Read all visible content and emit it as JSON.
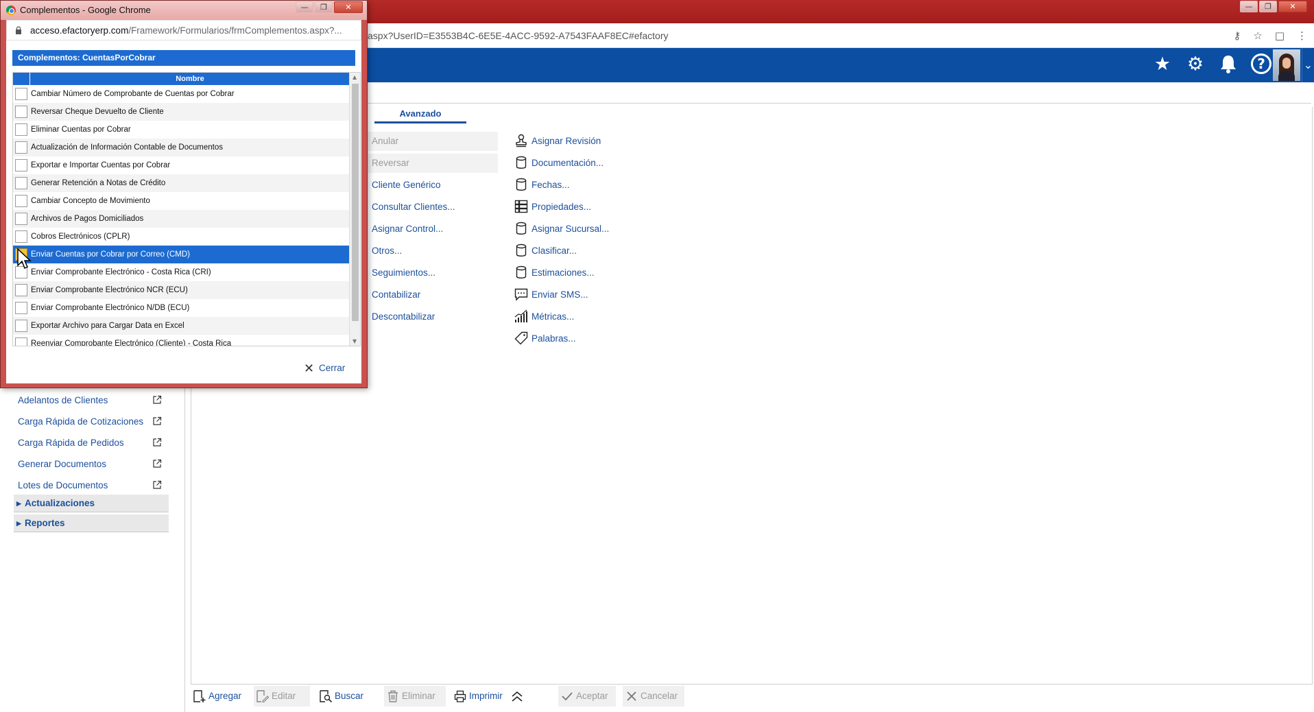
{
  "main_window": {
    "url": "aspx?UserID=E3553B4C-6E5E-4ACC-9592-A7543FAAF8EC#efactory"
  },
  "header": {
    "icons": [
      "star-icon",
      "gear-icon",
      "bell-icon",
      "help-icon"
    ],
    "brand_color": "#0b4ea2"
  },
  "tabs": {
    "active": "Avanzado"
  },
  "actions_left": [
    {
      "label": "Anular",
      "disabled": true
    },
    {
      "label": "Reversar",
      "disabled": true
    },
    {
      "label": "Cliente Genérico",
      "disabled": false
    },
    {
      "label": "Consultar Clientes...",
      "disabled": false
    },
    {
      "label": "Asignar Control...",
      "disabled": false
    },
    {
      "label": "Otros...",
      "disabled": false
    },
    {
      "label": "Seguimientos...",
      "disabled": false
    },
    {
      "label": "Contabilizar",
      "disabled": false
    },
    {
      "label": "Descontabilizar",
      "disabled": false
    }
  ],
  "actions_right": [
    {
      "label": "Asignar Revisión",
      "icon": "stamp-icon"
    },
    {
      "label": "Documentación...",
      "icon": "database-icon"
    },
    {
      "label": "Fechas...",
      "icon": "database-icon"
    },
    {
      "label": "Propiedades...",
      "icon": "grid-icon"
    },
    {
      "label": "Asignar Sucursal...",
      "icon": "database-icon"
    },
    {
      "label": "Clasificar...",
      "icon": "database-icon"
    },
    {
      "label": "Estimaciones...",
      "icon": "database-icon"
    },
    {
      "label": "Enviar SMS...",
      "icon": "chat-icon"
    },
    {
      "label": "Métricas...",
      "icon": "metrics-icon"
    },
    {
      "label": "Palabras...",
      "icon": "tag-icon"
    }
  ],
  "sidebar": {
    "links": [
      "Adelantos de Clientes",
      "Carga Rápida de Cotizaciones",
      "Carga Rápida de Pedidos",
      "Generar Documentos",
      "Lotes de Documentos"
    ],
    "sections": [
      "Actualizaciones",
      "Reportes"
    ]
  },
  "bottom_toolbar": [
    {
      "label": "Agregar",
      "disabled": false
    },
    {
      "label": "Editar",
      "disabled": true
    },
    {
      "label": "Buscar",
      "disabled": false
    },
    {
      "label": "Eliminar",
      "disabled": true
    },
    {
      "label": "Imprimir",
      "disabled": false
    },
    {
      "label": "Aceptar",
      "disabled": true
    },
    {
      "label": "Cancelar",
      "disabled": true
    }
  ],
  "popup": {
    "window_title": "Complementos - Google Chrome",
    "url_host": "acceso.efactoryerp.com",
    "url_path": "/Framework/Formularios/frmComplementos.aspx?...",
    "dialog_title": "Complementos: CuentasPorCobrar",
    "grid_header": "Nombre",
    "rows": [
      "Cambiar Número de Comprobante de Cuentas por Cobrar",
      "Reversar Cheque Devuelto de Cliente",
      "Eliminar Cuentas por Cobrar",
      "Actualización de Información Contable de Documentos",
      "Exportar e Importar Cuentas por Cobrar",
      "Generar Retención a Notas de Crédito",
      "Cambiar Concepto de Movimiento",
      "Archivos de Pagos Domiciliados",
      "Cobros Electrónicos (CPLR)",
      "Enviar Cuentas por Cobrar por Correo (CMD)",
      "Enviar Comprobante Electrónico - Costa Rica (CRI)",
      "Enviar Comprobante Electrónico NCR (ECU)",
      "Enviar Comprobante Electrónico N/DB (ECU)",
      "Exportar Archivo para Cargar Data en Excel",
      "Reenviar Comprobante Electrónico (Cliente) - Costa Rica"
    ],
    "selected_row": 9,
    "close_label": "Cerrar",
    "accent": "#1d6bd1"
  }
}
